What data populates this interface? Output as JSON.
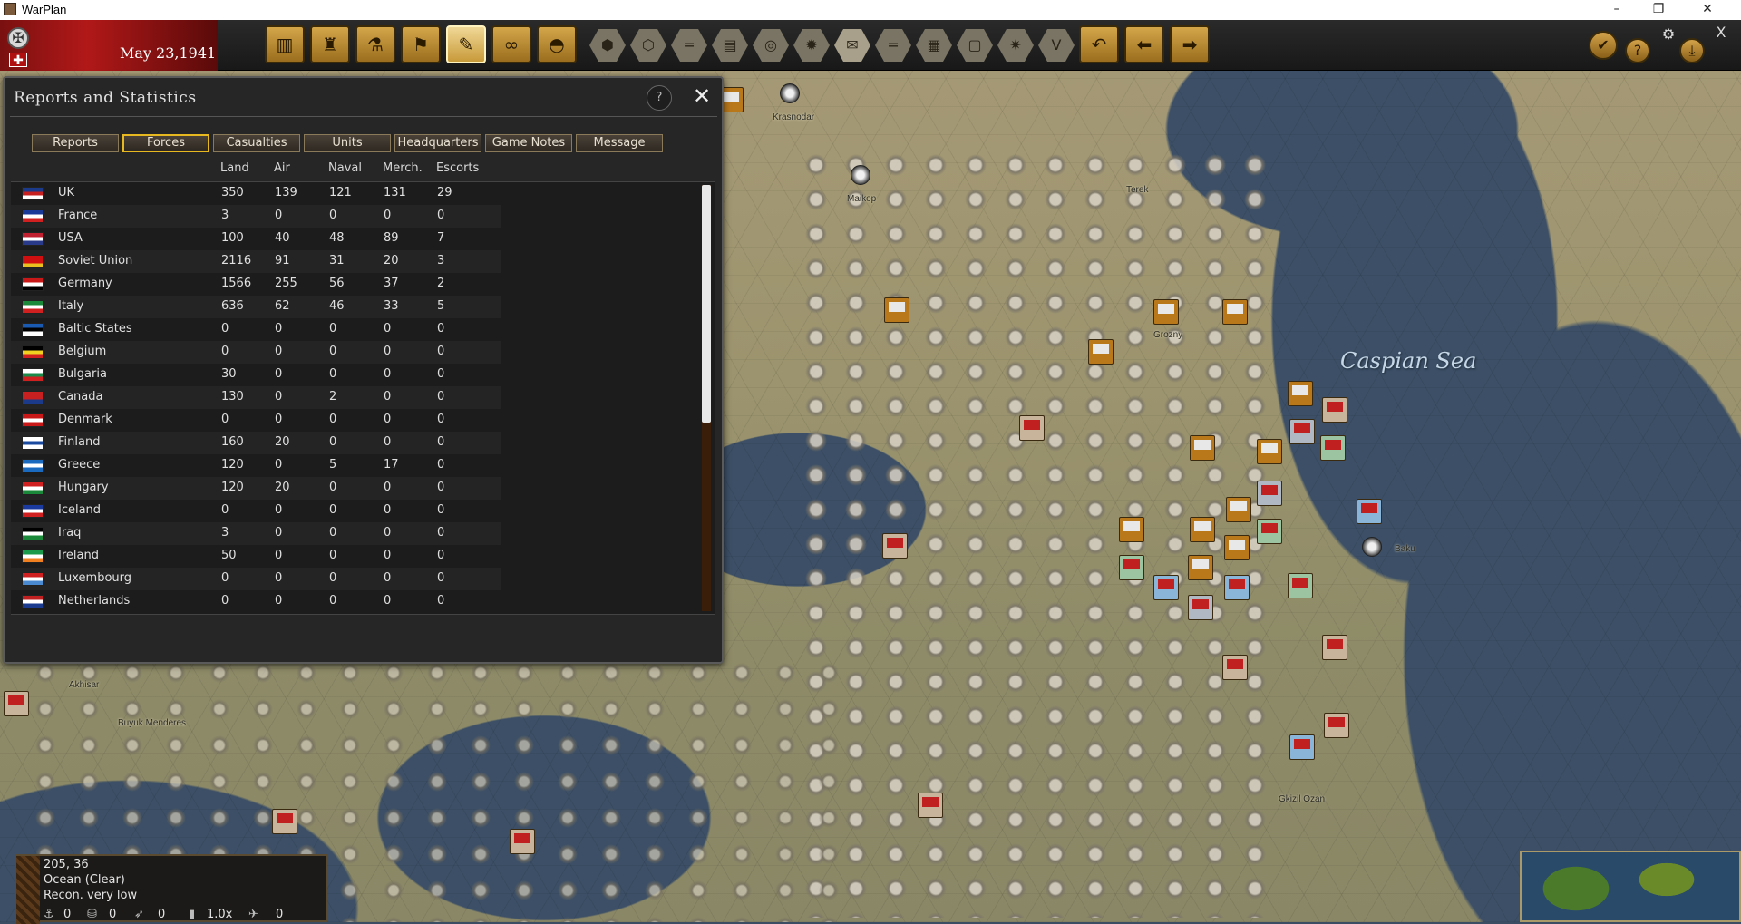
{
  "window": {
    "title": "WarPlan",
    "controls": [
      "–",
      "❐",
      "✕"
    ]
  },
  "toolbar": {
    "date": "May 23,1941",
    "main_buttons": [
      "factory-icon",
      "shell-icon",
      "microscope-icon",
      "flag-icon",
      "report-icon",
      "binoculars-icon",
      "helmet-icon"
    ],
    "hex_buttons": [
      "hex-terrain-icon",
      "hex-grid-icon",
      "hex-rail-icon",
      "hex-supply-icon",
      "hex-target-icon",
      "hex-sun-icon",
      "hex-mail-icon",
      "hex-lines-icon",
      "hex-box-icon",
      "hex-frame-icon",
      "hex-explosion-icon",
      "hex-v-icon"
    ],
    "hex_glyphs": [
      "⬢",
      "⬡",
      "═",
      "▤",
      "◎",
      "✹",
      "✉",
      "═",
      "▦",
      "▢",
      "✷",
      "V"
    ],
    "nav_buttons": [
      "undo-icon",
      "back-arrow-icon",
      "forward-arrow-icon"
    ],
    "nav_glyphs": [
      "↶",
      "⬅",
      "➡"
    ],
    "right_buttons": [
      "✔",
      "?",
      "⚙",
      "⤓",
      "X"
    ]
  },
  "panel": {
    "title": "Reports and Statistics",
    "help_label": "?",
    "close_label": "✕",
    "tabs": [
      "Reports",
      "Forces",
      "Casualties",
      "Units",
      "Headquarters",
      "Game Notes",
      "Message"
    ],
    "active_tab": "Forces",
    "columns": [
      "Land",
      "Air",
      "Naval",
      "Merch.",
      "Escorts"
    ],
    "rows": [
      {
        "name": "UK",
        "land": "350",
        "air": "139",
        "naval": "121",
        "merch": "131",
        "escorts": "29",
        "flag_colors": [
          "#1c3a8a",
          "#c82020",
          "#ffffff"
        ]
      },
      {
        "name": "France",
        "land": "3",
        "air": "0",
        "naval": "0",
        "merch": "0",
        "escorts": "0",
        "flag_colors": [
          "#1a3a9a",
          "#ffffff",
          "#d02020"
        ]
      },
      {
        "name": "USA",
        "land": "100",
        "air": "40",
        "naval": "48",
        "merch": "89",
        "escorts": "7",
        "flag_colors": [
          "#c02030",
          "#ffffff",
          "#2a3a8a"
        ]
      },
      {
        "name": "Soviet Union",
        "land": "2116",
        "air": "91",
        "naval": "31",
        "merch": "20",
        "escorts": "3",
        "flag_colors": [
          "#d01010",
          "#d01010",
          "#e8c020"
        ]
      },
      {
        "name": "Germany",
        "land": "1566",
        "air": "255",
        "naval": "56",
        "merch": "37",
        "escorts": "2",
        "flag_colors": [
          "#c81818",
          "#ffffff",
          "#000000"
        ]
      },
      {
        "name": "Italy",
        "land": "636",
        "air": "62",
        "naval": "46",
        "merch": "33",
        "escorts": "5",
        "flag_colors": [
          "#1a8a3a",
          "#ffffff",
          "#d02020"
        ]
      },
      {
        "name": "Baltic States",
        "land": "0",
        "air": "0",
        "naval": "0",
        "merch": "0",
        "escorts": "0",
        "flag_colors": [
          "#1a5ab0",
          "#000000",
          "#ffffff"
        ]
      },
      {
        "name": "Belgium",
        "land": "0",
        "air": "0",
        "naval": "0",
        "merch": "0",
        "escorts": "0",
        "flag_colors": [
          "#000000",
          "#f0d020",
          "#d02020"
        ]
      },
      {
        "name": "Bulgaria",
        "land": "30",
        "air": "0",
        "naval": "0",
        "merch": "0",
        "escorts": "0",
        "flag_colors": [
          "#ffffff",
          "#1a8a4a",
          "#d02020"
        ]
      },
      {
        "name": "Canada",
        "land": "130",
        "air": "0",
        "naval": "2",
        "merch": "0",
        "escorts": "0",
        "flag_colors": [
          "#c82020",
          "#c82020",
          "#1c3a8a"
        ]
      },
      {
        "name": "Denmark",
        "land": "0",
        "air": "0",
        "naval": "0",
        "merch": "0",
        "escorts": "0",
        "flag_colors": [
          "#c81818",
          "#ffffff",
          "#c81818"
        ]
      },
      {
        "name": "Finland",
        "land": "160",
        "air": "20",
        "naval": "0",
        "merch": "0",
        "escorts": "0",
        "flag_colors": [
          "#ffffff",
          "#1a4aa0",
          "#ffffff"
        ]
      },
      {
        "name": "Greece",
        "land": "120",
        "air": "0",
        "naval": "5",
        "merch": "17",
        "escorts": "0",
        "flag_colors": [
          "#1a6ac0",
          "#ffffff",
          "#1a6ac0"
        ]
      },
      {
        "name": "Hungary",
        "land": "120",
        "air": "20",
        "naval": "0",
        "merch": "0",
        "escorts": "0",
        "flag_colors": [
          "#d02020",
          "#ffffff",
          "#1a8a3a"
        ]
      },
      {
        "name": "Iceland",
        "land": "0",
        "air": "0",
        "naval": "0",
        "merch": "0",
        "escorts": "0",
        "flag_colors": [
          "#1a3aa0",
          "#ffffff",
          "#d02020"
        ]
      },
      {
        "name": "Iraq",
        "land": "3",
        "air": "0",
        "naval": "0",
        "merch": "0",
        "escorts": "0",
        "flag_colors": [
          "#000000",
          "#ffffff",
          "#1a8a3a"
        ]
      },
      {
        "name": "Ireland",
        "land": "50",
        "air": "0",
        "naval": "0",
        "merch": "0",
        "escorts": "0",
        "flag_colors": [
          "#1a9a4a",
          "#ffffff",
          "#f08020"
        ]
      },
      {
        "name": "Luxembourg",
        "land": "0",
        "air": "0",
        "naval": "0",
        "merch": "0",
        "escorts": "0",
        "flag_colors": [
          "#d02020",
          "#ffffff",
          "#4a8ad0"
        ]
      },
      {
        "name": "Netherlands",
        "land": "0",
        "air": "0",
        "naval": "0",
        "merch": "0",
        "escorts": "0",
        "flag_colors": [
          "#c02020",
          "#ffffff",
          "#1a3a90"
        ]
      }
    ]
  },
  "map": {
    "sea_label": "Caspian Sea",
    "cities": [
      {
        "name": "Krasnodar"
      },
      {
        "name": "Maikop"
      },
      {
        "name": "Grozny"
      },
      {
        "name": "Baku"
      },
      {
        "name": "Terek"
      },
      {
        "name": "Akhisar"
      },
      {
        "name": "Buyuk Menderes"
      },
      {
        "name": "Gkizil Ozan"
      }
    ]
  },
  "infobox": {
    "coords": "205, 36",
    "terrain": "Ocean (Clear)",
    "recon": "Recon. very low",
    "stats": [
      "0",
      "0",
      "0",
      "1.0x",
      "0"
    ],
    "stat_icons": [
      "⚓",
      "⛁",
      "➶",
      "▮",
      "✈"
    ]
  }
}
